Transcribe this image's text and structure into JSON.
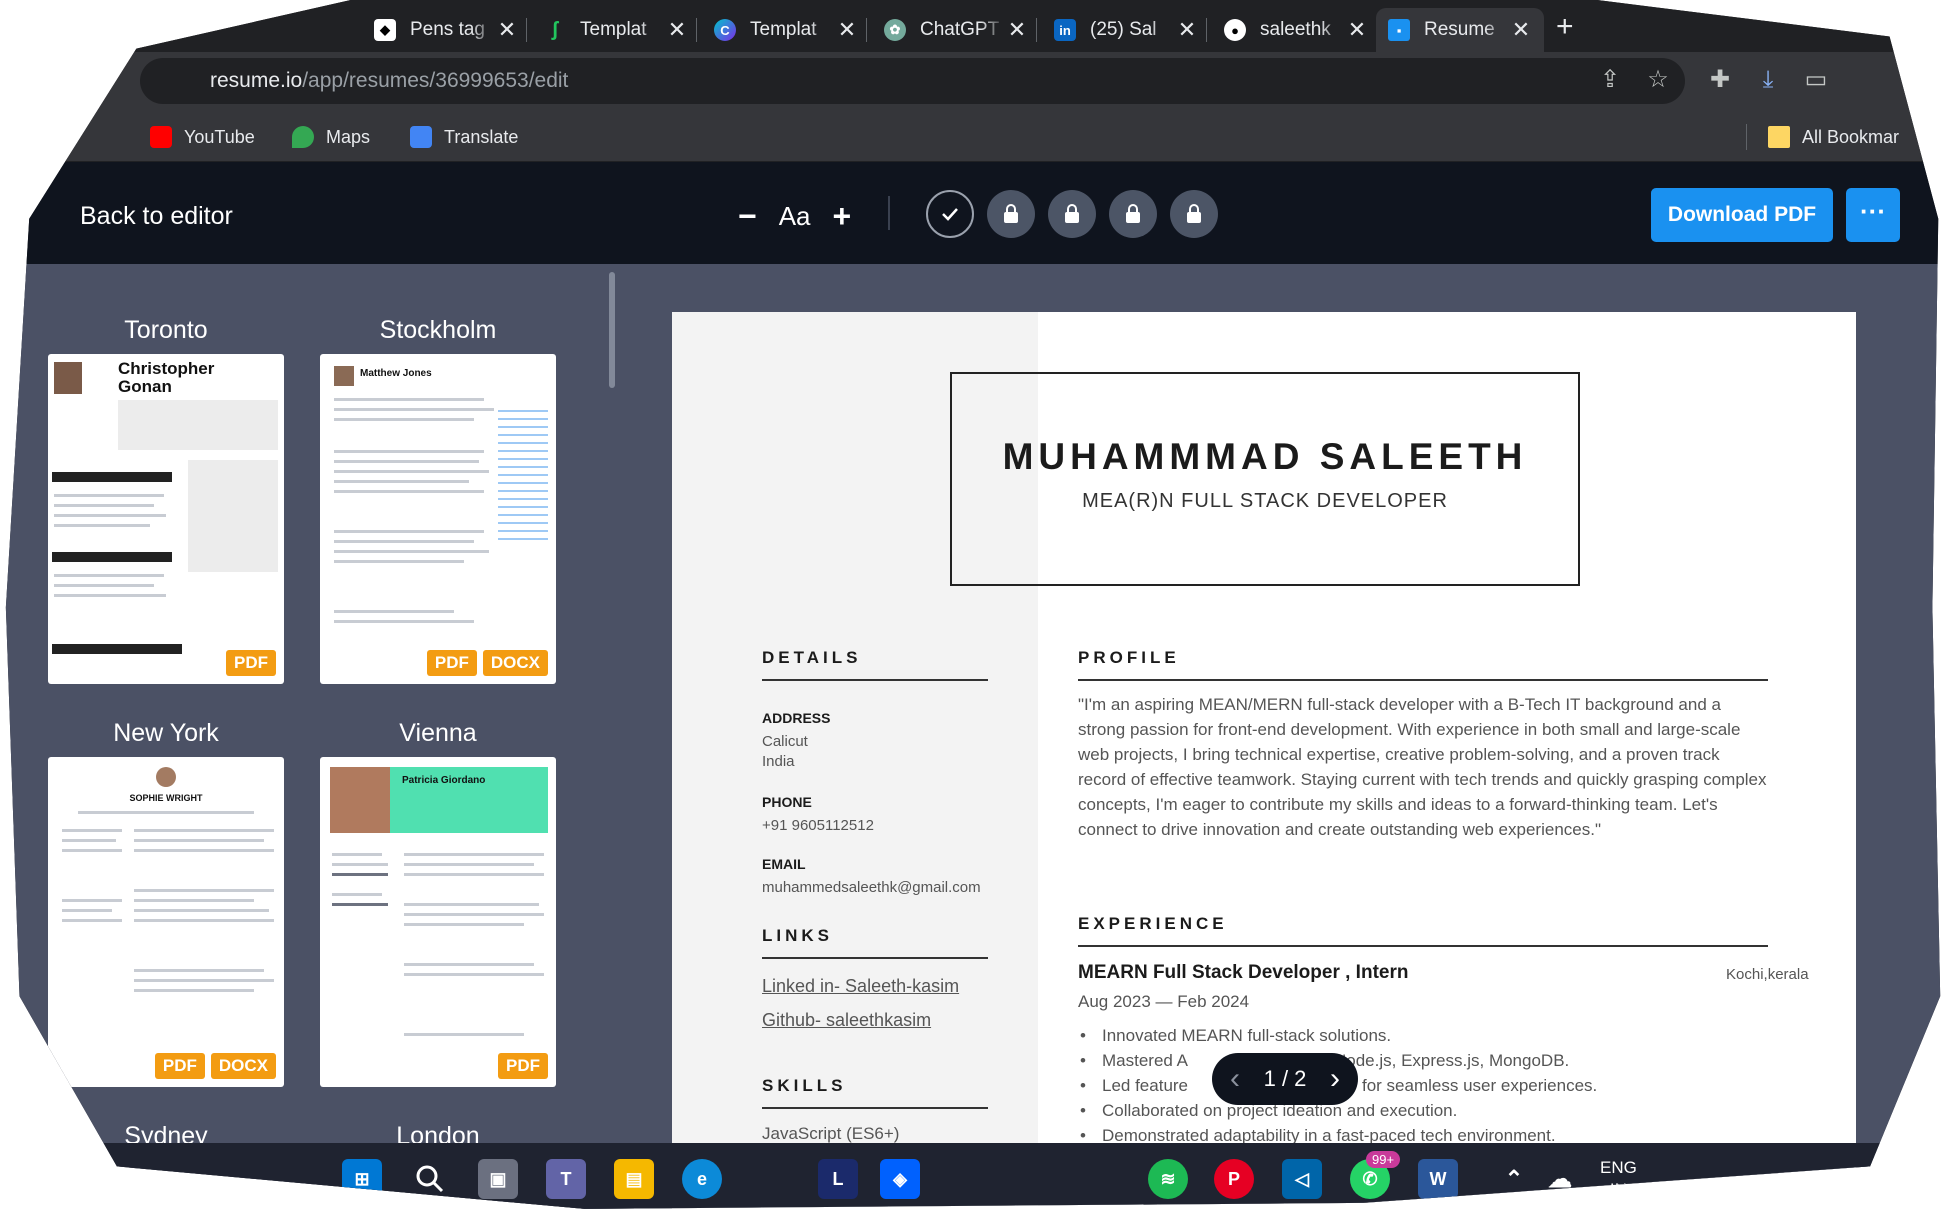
{
  "browser": {
    "tabs": [
      {
        "title": "Pens tag",
        "icon": "codepen-icon"
      },
      {
        "title": "Templat",
        "icon": "template-icon"
      },
      {
        "title": "Templat",
        "icon": "canva-icon"
      },
      {
        "title": "ChatGPT",
        "icon": "chatgpt-icon"
      },
      {
        "title": "(25) Sal",
        "icon": "linkedin-icon"
      },
      {
        "title": "saleethk",
        "icon": "github-icon"
      },
      {
        "title": "Resume",
        "icon": "resume-icon"
      }
    ],
    "close_glyph": "✕",
    "new_tab": "+",
    "url_host": "resume.io",
    "url_path": "/app/resumes/36999653/edit",
    "bookmarks": [
      {
        "label": "YouTube",
        "color": "#ff0000"
      },
      {
        "label": "Maps",
        "color": "#34a853"
      },
      {
        "label": "Translate",
        "color": "#4285f4"
      }
    ],
    "all_bookmarks": "All Bookmar"
  },
  "editor": {
    "back_label": "Back to editor",
    "font_minus": "−",
    "font_label": "Aa",
    "font_plus": "+",
    "download_label": "Download PDF",
    "more_label": "···",
    "accent": "#1a91f0"
  },
  "templates": [
    {
      "name": "Toronto",
      "badges": [
        "PDF"
      ],
      "thumb_name": "Christopher Gonan"
    },
    {
      "name": "Stockholm",
      "badges": [
        "PDF",
        "DOCX"
      ],
      "thumb_name": "Matthew Jones"
    },
    {
      "name": "New York",
      "badges": [
        "PDF",
        "DOCX"
      ],
      "thumb_name": "SOPHIE WRIGHT"
    },
    {
      "name": "Vienna",
      "badges": [
        "PDF"
      ],
      "thumb_name": "Patricia Giordano"
    },
    {
      "name": "Sydney",
      "badges": []
    },
    {
      "name": "London",
      "badges": []
    }
  ],
  "resume": {
    "name": "MUHAMMMAD SALEETH",
    "title": "MEA(R)N FULL STACK DEVELOPER",
    "details_heading": "DETAILS",
    "address_label": "ADDRESS",
    "address_line1": "Calicut",
    "address_line2": "India",
    "phone_label": "PHONE",
    "phone": "+91 9605112512",
    "email_label": "EMAIL",
    "email": "muhammedsaleethk@gmail.com",
    "links_heading": "LINKS",
    "link1": "Linked in- Saleeth-kasim",
    "link2": "Github- saleethkasim",
    "skills_heading": "SKILLS",
    "skill1": "JavaScript (ES6+)",
    "profile_heading": "PROFILE",
    "profile": "\"I'm an aspiring MEAN/MERN full-stack developer with a B-Tech IT background and a strong passion for front-end development. With experience in both small and large-scale web projects, I bring technical expertise, creative problem-solving, and a proven track record of effective teamwork. Staying current with tech trends and quickly grasping complex concepts, I'm eager to contribute my skills and ideas to a forward-thinking team. Let's connect to drive innovation and create outstanding web experiences.\"",
    "experience_heading": "EXPERIENCE",
    "job_title": "MEARN Full Stack Developer , Intern",
    "job_location": "Kochi,kerala",
    "job_dates": "Aug 2023 — Feb 2024",
    "bullets": [
      "Innovated MEARN full-stack solutions.",
      "Mastered A",
      "Node.js, Express.js, MongoDB.",
      "Led feature",
      "for seamless user experiences.",
      "Collaborated on project ideation and execution.",
      "Demonstrated adaptability in a fast-paced tech environment."
    ]
  },
  "pager": {
    "label": "1 / 2",
    "prev": "‹",
    "next": "›"
  },
  "taskbar": {
    "badge": "99+",
    "lang1": "ENG",
    "lang2": "IN"
  }
}
